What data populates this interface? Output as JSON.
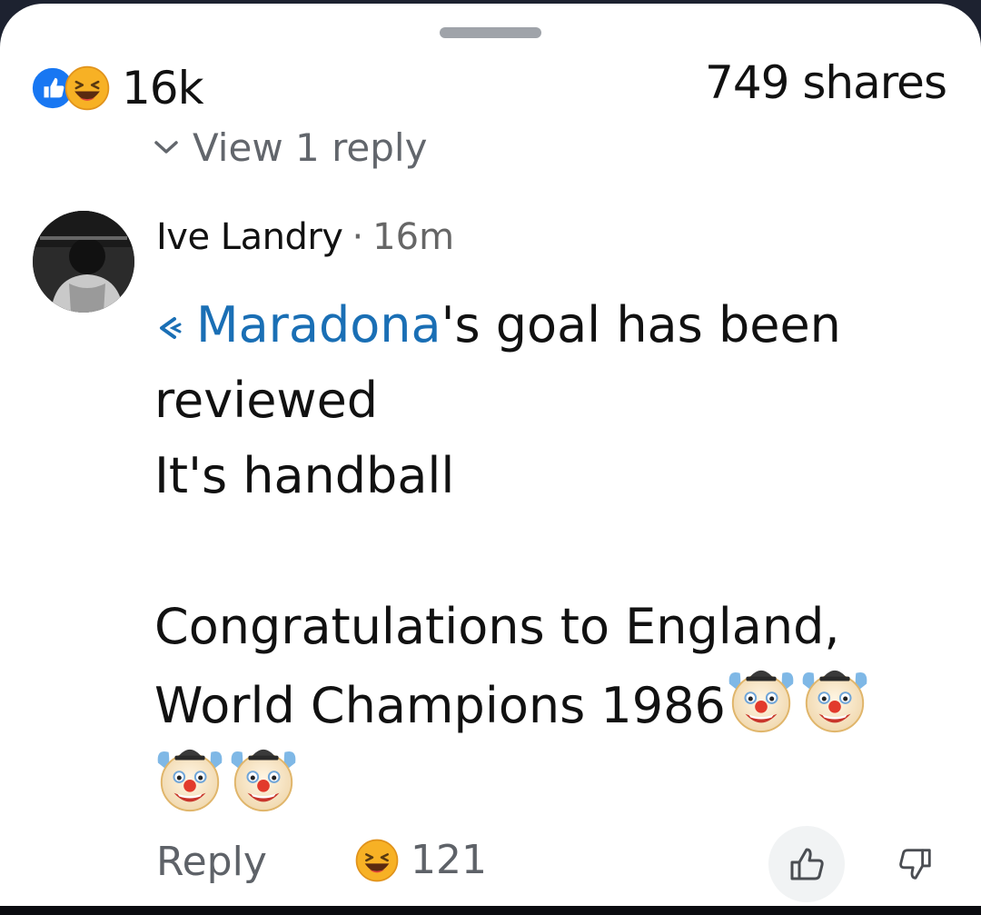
{
  "reactions": {
    "count": "16k",
    "icons": [
      "like-icon",
      "haha-icon"
    ],
    "colors": {
      "like": "#1877f2",
      "haha": "#f7b125"
    }
  },
  "shares": "749 shares",
  "view_replies": "View 1 reply",
  "comment": {
    "author": "Ive Landry",
    "separator": "·",
    "time": "16m",
    "mention": "Maradona",
    "mention_color": "#1a6fb5",
    "line1_rest": "'s goal has been",
    "line2": "reviewed",
    "line3": "It's handball",
    "line5": "Congratulations to England,",
    "line6": "World Champions 1986",
    "emoji_name": "clown-face-emoji"
  },
  "footer": {
    "reply_label": "Reply",
    "laugh_count": "121"
  }
}
